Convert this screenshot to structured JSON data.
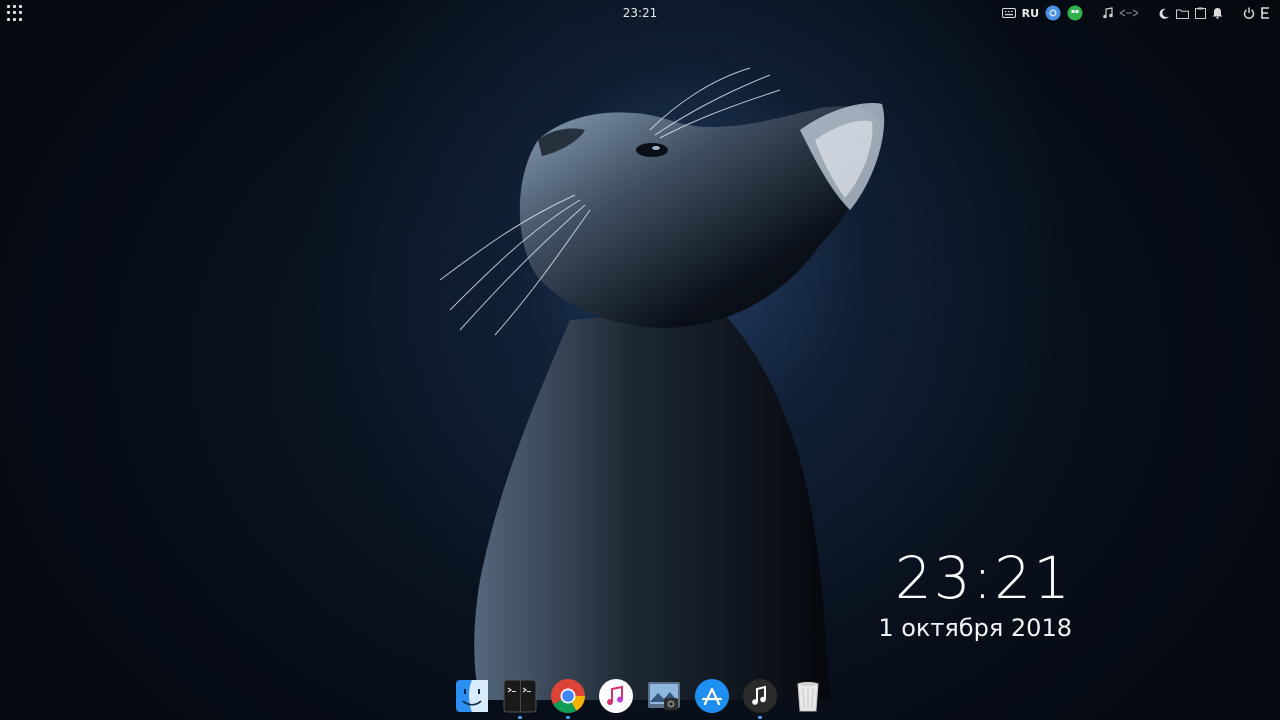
{
  "panel": {
    "clock": "23:21",
    "keyboard_layout": "RU"
  },
  "widget": {
    "time": "23:21",
    "date": "1 октября 2018"
  },
  "tray_icons": [
    "keyboard-icon",
    "chromium-icon",
    "hangouts-icon",
    "music-note-icon",
    "network-icon",
    "night-mode-icon",
    "folder-icon",
    "notification-bell-icon",
    "power-icon",
    "extra-menu-icon"
  ],
  "dock_icons": [
    "finder-icon",
    "terminal-icon",
    "chrome-icon",
    "itunes-icon",
    "image-viewer-icon",
    "app-store-icon",
    "music-player-icon",
    "trash-icon"
  ],
  "colors": {
    "accent": "#4a9cff",
    "panel_text": "#e8e8e8"
  }
}
